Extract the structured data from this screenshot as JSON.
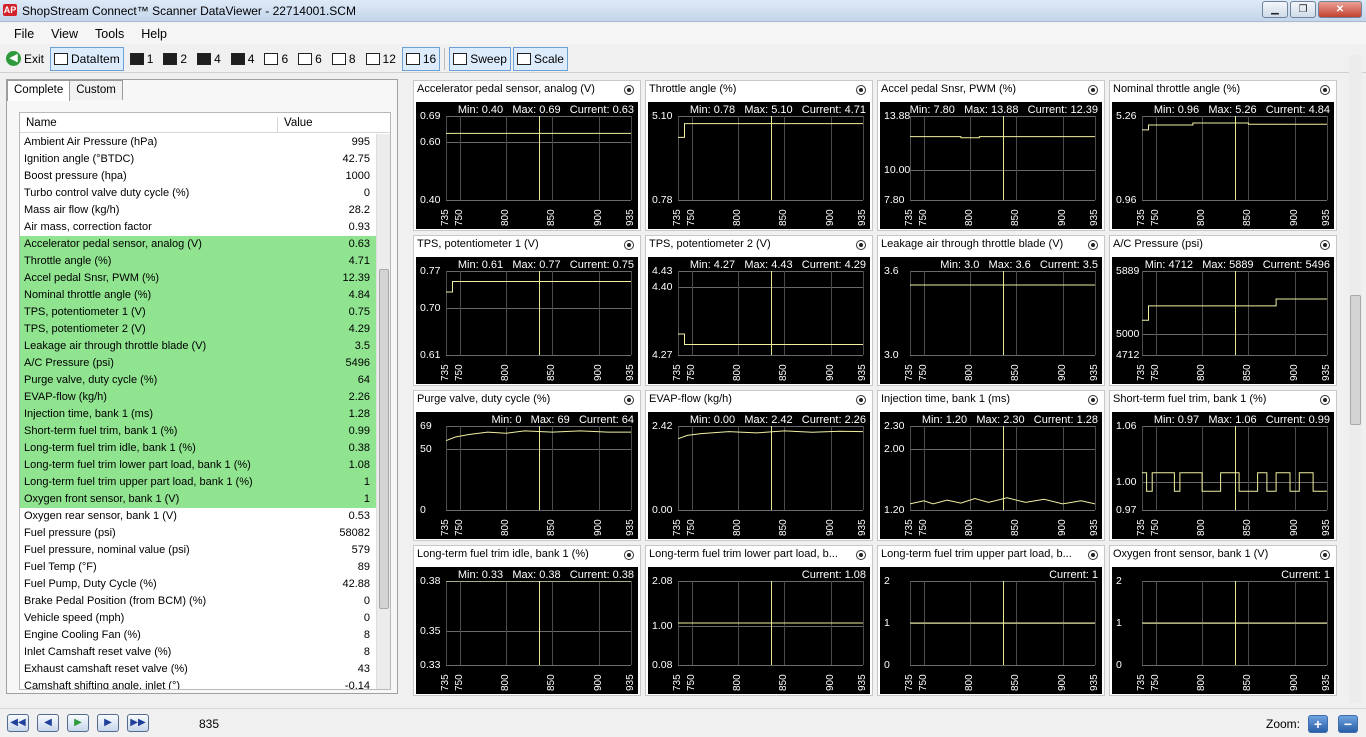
{
  "window": {
    "title": "ShopStream Connect™ Scanner DataViewer - 22714001.SCM",
    "app_icon": "AP"
  },
  "menu": [
    "File",
    "View",
    "Tools",
    "Help"
  ],
  "toolbar": {
    "exit": "Exit",
    "dataitem": "DataItem",
    "layouts": [
      "1",
      "2",
      "4",
      "4",
      "6",
      "6",
      "8",
      "12",
      "16"
    ],
    "selected_layout": "16",
    "sweep": "Sweep",
    "scale": "Scale"
  },
  "left_panel": {
    "tabs": [
      "Complete",
      "Custom"
    ],
    "active_tab": "Complete",
    "columns": [
      "Name",
      "Value"
    ],
    "rows": [
      {
        "name": "Ambient Air Pressure (hPa)",
        "value": "995",
        "hl": false
      },
      {
        "name": "Ignition angle (°BTDC)",
        "value": "42.75",
        "hl": false
      },
      {
        "name": "Boost pressure (hpa)",
        "value": "1000",
        "hl": false
      },
      {
        "name": "Turbo control valve duty cycle (%)",
        "value": "0",
        "hl": false
      },
      {
        "name": "Mass air flow (kg/h)",
        "value": "28.2",
        "hl": false
      },
      {
        "name": "Air mass, correction factor",
        "value": "0.93",
        "hl": false
      },
      {
        "name": "Accelerator pedal sensor, analog (V)",
        "value": "0.63",
        "hl": true
      },
      {
        "name": "Throttle angle (%)",
        "value": "4.71",
        "hl": true
      },
      {
        "name": "Accel pedal Snsr, PWM (%)",
        "value": "12.39",
        "hl": true
      },
      {
        "name": "Nominal throttle angle (%)",
        "value": "4.84",
        "hl": true
      },
      {
        "name": "TPS, potentiometer 1 (V)",
        "value": "0.75",
        "hl": true
      },
      {
        "name": "TPS, potentiometer 2 (V)",
        "value": "4.29",
        "hl": true
      },
      {
        "name": "Leakage air through throttle blade (V)",
        "value": "3.5",
        "hl": true
      },
      {
        "name": "A/C Pressure (psi)",
        "value": "5496",
        "hl": true
      },
      {
        "name": "Purge valve, duty cycle (%)",
        "value": "64",
        "hl": true
      },
      {
        "name": "EVAP-flow (kg/h)",
        "value": "2.26",
        "hl": true
      },
      {
        "name": "Injection time, bank 1 (ms)",
        "value": "1.28",
        "hl": true
      },
      {
        "name": "Short-term fuel trim, bank 1 (%)",
        "value": "0.99",
        "hl": true
      },
      {
        "name": "Long-term fuel trim idle, bank 1 (%)",
        "value": "0.38",
        "hl": true
      },
      {
        "name": "Long-term fuel trim lower part load, bank 1 (%)",
        "value": "1.08",
        "hl": true
      },
      {
        "name": "Long-term fuel trim upper part load, bank 1 (%)",
        "value": "1",
        "hl": true
      },
      {
        "name": "Oxygen front sensor, bank 1 (V)",
        "value": "1",
        "hl": true
      },
      {
        "name": "Oxygen rear sensor, bank 1 (V)",
        "value": "0.53",
        "hl": false
      },
      {
        "name": "Fuel pressure (psi)",
        "value": "58082",
        "hl": false
      },
      {
        "name": "Fuel pressure, nominal value (psi)",
        "value": "579",
        "hl": false
      },
      {
        "name": "Fuel Temp (°F)",
        "value": "89",
        "hl": false
      },
      {
        "name": "Fuel Pump, Duty Cycle (%)",
        "value": "42.88",
        "hl": false
      },
      {
        "name": "Brake Pedal Position (from BCM) (%)",
        "value": "0",
        "hl": false
      },
      {
        "name": "Vehicle speed (mph)",
        "value": "0",
        "hl": false
      },
      {
        "name": "Engine Cooling Fan (%)",
        "value": "8",
        "hl": false
      },
      {
        "name": "Inlet Camshaft reset valve (%)",
        "value": "8",
        "hl": false
      },
      {
        "name": "Exhaust camshaft reset valve (%)",
        "value": "43",
        "hl": false
      },
      {
        "name": "Camshaft shifting angle, inlet (°)",
        "value": "-0.14",
        "hl": false
      }
    ]
  },
  "graphs": {
    "x_ticks": [
      "735",
      "750",
      "800",
      "850",
      "900",
      "935"
    ],
    "cursor": 835,
    "trace_color": "#f0f0a0",
    "panels": [
      {
        "title": "Accelerator pedal sensor, analog (V)",
        "min": "Min: 0.40",
        "max": "Max: 0.69",
        "current": "Current: 0.63",
        "ylabels": [
          {
            "t": "0.69",
            "v": 0.69
          },
          {
            "t": "0.60",
            "v": 0.6
          },
          {
            "t": "0.40",
            "v": 0.4
          }
        ],
        "ylim": [
          0.4,
          0.69
        ],
        "trace": [
          [
            735,
            0.63
          ],
          [
            935,
            0.63
          ]
        ]
      },
      {
        "title": "Throttle angle (%)",
        "min": "Min: 0.78",
        "max": "Max: 5.10",
        "current": "Current: 4.71",
        "ylabels": [
          {
            "t": "5.10",
            "v": 5.1
          },
          {
            "t": "0.78",
            "v": 0.78
          }
        ],
        "ylim": [
          0.78,
          5.1
        ],
        "trace": [
          [
            735,
            4.0
          ],
          [
            742,
            4.0
          ],
          [
            742,
            4.71
          ],
          [
            935,
            4.71
          ]
        ]
      },
      {
        "title": "Accel pedal Snsr, PWM (%)",
        "min": "Min: 7.80",
        "max": "Max: 13.88",
        "current": "Current: 12.39",
        "ylabels": [
          {
            "t": "13.88",
            "v": 13.88
          },
          {
            "t": "10.00",
            "v": 10.0
          },
          {
            "t": "7.80",
            "v": 7.8
          }
        ],
        "ylim": [
          7.8,
          13.88
        ],
        "trace": [
          [
            735,
            12.39
          ],
          [
            790,
            12.39
          ],
          [
            790,
            12.3
          ],
          [
            810,
            12.3
          ],
          [
            810,
            12.39
          ],
          [
            935,
            12.39
          ]
        ]
      },
      {
        "title": "Nominal throttle angle (%)",
        "min": "Min: 0.96",
        "max": "Max: 5.26",
        "current": "Current: 4.84",
        "ylabels": [
          {
            "t": "5.26",
            "v": 5.26
          },
          {
            "t": "0.96",
            "v": 0.96
          }
        ],
        "ylim": [
          0.96,
          5.26
        ],
        "trace": [
          [
            735,
            4.55
          ],
          [
            742,
            4.55
          ],
          [
            742,
            4.8
          ],
          [
            790,
            4.8
          ],
          [
            790,
            4.9
          ],
          [
            850,
            4.9
          ],
          [
            850,
            4.84
          ],
          [
            935,
            4.84
          ]
        ]
      },
      {
        "title": "TPS, potentiometer 1 (V)",
        "min": "Min: 0.61",
        "max": "Max: 0.77",
        "current": "Current: 0.75",
        "ylabels": [
          {
            "t": "0.77",
            "v": 0.77
          },
          {
            "t": "0.70",
            "v": 0.7
          },
          {
            "t": "0.61",
            "v": 0.61
          }
        ],
        "ylim": [
          0.61,
          0.77
        ],
        "trace": [
          [
            735,
            0.73
          ],
          [
            742,
            0.73
          ],
          [
            742,
            0.75
          ],
          [
            935,
            0.75
          ]
        ]
      },
      {
        "title": "TPS, potentiometer 2 (V)",
        "min": "Min: 4.27",
        "max": "Max: 4.43",
        "current": "Current: 4.29",
        "ylabels": [
          {
            "t": "4.43",
            "v": 4.43
          },
          {
            "t": "4.40",
            "v": 4.4
          },
          {
            "t": "4.27",
            "v": 4.27
          }
        ],
        "ylim": [
          4.27,
          4.43
        ],
        "trace": [
          [
            735,
            4.31
          ],
          [
            742,
            4.31
          ],
          [
            742,
            4.29
          ],
          [
            935,
            4.29
          ]
        ]
      },
      {
        "title": "Leakage air through throttle blade (V)",
        "min": "Min: 3.0",
        "max": "Max: 3.6",
        "current": "Current: 3.5",
        "ylabels": [
          {
            "t": "3.6",
            "v": 3.6
          },
          {
            "t": "3.0",
            "v": 3.0
          }
        ],
        "ylim": [
          3.0,
          3.6
        ],
        "trace": [
          [
            735,
            3.5
          ],
          [
            935,
            3.5
          ]
        ]
      },
      {
        "title": "A/C Pressure (psi)",
        "min": "Min: 4712",
        "max": "Max: 5889",
        "current": "Current: 5496",
        "ylabels": [
          {
            "t": "5889",
            "v": 5889
          },
          {
            "t": "5000",
            "v": 5000
          },
          {
            "t": "4712",
            "v": 4712
          }
        ],
        "ylim": [
          4712,
          5889
        ],
        "trace": [
          [
            735,
            5200
          ],
          [
            742,
            5200
          ],
          [
            742,
            5400
          ],
          [
            880,
            5400
          ],
          [
            880,
            5496
          ],
          [
            935,
            5496
          ]
        ]
      },
      {
        "title": "Purge valve, duty cycle (%)",
        "min": "Min: 0",
        "max": "Max: 69",
        "current": "Current: 64",
        "ylabels": [
          {
            "t": "69",
            "v": 69
          },
          {
            "t": "50",
            "v": 50
          },
          {
            "t": "0",
            "v": 0
          }
        ],
        "ylim": [
          0,
          69
        ],
        "trace": [
          [
            735,
            57
          ],
          [
            745,
            60
          ],
          [
            760,
            62
          ],
          [
            780,
            64
          ],
          [
            800,
            63
          ],
          [
            820,
            65
          ],
          [
            850,
            64
          ],
          [
            880,
            65
          ],
          [
            910,
            64
          ],
          [
            935,
            64
          ]
        ]
      },
      {
        "title": "EVAP-flow (kg/h)",
        "min": "Min: 0.00",
        "max": "Max: 2.42",
        "current": "Current: 2.26",
        "ylabels": [
          {
            "t": "2.42",
            "v": 2.42
          },
          {
            "t": "0.00",
            "v": 0.0
          }
        ],
        "ylim": [
          0,
          2.42
        ],
        "trace": [
          [
            735,
            2.05
          ],
          [
            745,
            2.15
          ],
          [
            760,
            2.2
          ],
          [
            790,
            2.26
          ],
          [
            820,
            2.22
          ],
          [
            850,
            2.28
          ],
          [
            880,
            2.24
          ],
          [
            910,
            2.27
          ],
          [
            935,
            2.26
          ]
        ]
      },
      {
        "title": "Injection time, bank 1 (ms)",
        "min": "Min: 1.20",
        "max": "Max: 2.30",
        "current": "Current: 1.28",
        "ylabels": [
          {
            "t": "2.30",
            "v": 2.3
          },
          {
            "t": "2.00",
            "v": 2.0
          },
          {
            "t": "1.20",
            "v": 1.2
          }
        ],
        "ylim": [
          1.2,
          2.3
        ],
        "trace": [
          [
            735,
            1.28
          ],
          [
            750,
            1.32
          ],
          [
            760,
            1.28
          ],
          [
            775,
            1.33
          ],
          [
            790,
            1.29
          ],
          [
            805,
            1.35
          ],
          [
            820,
            1.3
          ],
          [
            840,
            1.36
          ],
          [
            860,
            1.3
          ],
          [
            880,
            1.34
          ],
          [
            900,
            1.28
          ],
          [
            920,
            1.32
          ],
          [
            935,
            1.28
          ]
        ]
      },
      {
        "title": "Short-term fuel trim, bank 1 (%)",
        "min": "Min: 0.97",
        "max": "Max: 1.06",
        "current": "Current: 0.99",
        "ylabels": [
          {
            "t": "1.06",
            "v": 1.06
          },
          {
            "t": "1.00",
            "v": 1.0
          },
          {
            "t": "0.97",
            "v": 0.97
          }
        ],
        "ylim": [
          0.97,
          1.06
        ],
        "trace": [
          [
            735,
            1.01
          ],
          [
            740,
            1.01
          ],
          [
            740,
            0.99
          ],
          [
            746,
            0.99
          ],
          [
            746,
            1.01
          ],
          [
            770,
            1.01
          ],
          [
            770,
            0.99
          ],
          [
            776,
            0.99
          ],
          [
            776,
            1.01
          ],
          [
            800,
            1.01
          ],
          [
            800,
            0.99
          ],
          [
            820,
            0.99
          ],
          [
            820,
            1.01
          ],
          [
            840,
            1.01
          ],
          [
            840,
            0.99
          ],
          [
            860,
            0.99
          ],
          [
            860,
            1.01
          ],
          [
            870,
            1.01
          ],
          [
            870,
            0.99
          ],
          [
            880,
            0.99
          ],
          [
            880,
            1.01
          ],
          [
            895,
            1.01
          ],
          [
            895,
            0.99
          ],
          [
            905,
            0.99
          ],
          [
            905,
            1.01
          ],
          [
            920,
            1.01
          ],
          [
            920,
            0.99
          ],
          [
            935,
            0.99
          ]
        ]
      },
      {
        "title": "Long-term fuel trim idle, bank 1 (%)",
        "min": "Min: 0.33",
        "max": "Max: 0.38",
        "current": "Current: 0.38",
        "ylabels": [
          {
            "t": "0.38",
            "v": 0.38
          },
          {
            "t": "0.35",
            "v": 0.35
          },
          {
            "t": "0.33",
            "v": 0.33
          }
        ],
        "ylim": [
          0.33,
          0.38
        ],
        "trace": [
          [
            735,
            0.38
          ],
          [
            935,
            0.38
          ]
        ]
      },
      {
        "title": "Long-term fuel trim lower part load, b...",
        "min": "",
        "max": "",
        "current": "Current: 1.08",
        "ylabels": [
          {
            "t": "2.08",
            "v": 2.08
          },
          {
            "t": "1.00",
            "v": 1.0
          },
          {
            "t": "0.08",
            "v": 0.08
          }
        ],
        "ylim": [
          0.08,
          2.08
        ],
        "trace": [
          [
            735,
            1.08
          ],
          [
            935,
            1.08
          ]
        ]
      },
      {
        "title": "Long-term fuel trim upper part load, b...",
        "min": "",
        "max": "",
        "current": "Current: 1",
        "ylabels": [
          {
            "t": "2",
            "v": 2
          },
          {
            "t": "1",
            "v": 1
          },
          {
            "t": "0",
            "v": 0
          }
        ],
        "ylim": [
          0,
          2
        ],
        "trace": [
          [
            735,
            1
          ],
          [
            935,
            1
          ]
        ]
      },
      {
        "title": "Oxygen front sensor, bank 1 (V)",
        "min": "",
        "max": "",
        "current": "Current: 1",
        "ylabels": [
          {
            "t": "2",
            "v": 2
          },
          {
            "t": "1",
            "v": 1
          },
          {
            "t": "0",
            "v": 0
          }
        ],
        "ylim": [
          0,
          2
        ],
        "trace": [
          [
            735,
            1
          ],
          [
            935,
            1
          ]
        ]
      }
    ]
  },
  "status": {
    "frame": "835",
    "zoom_label": "Zoom:",
    "zoom_in": "+",
    "zoom_out": "−"
  }
}
